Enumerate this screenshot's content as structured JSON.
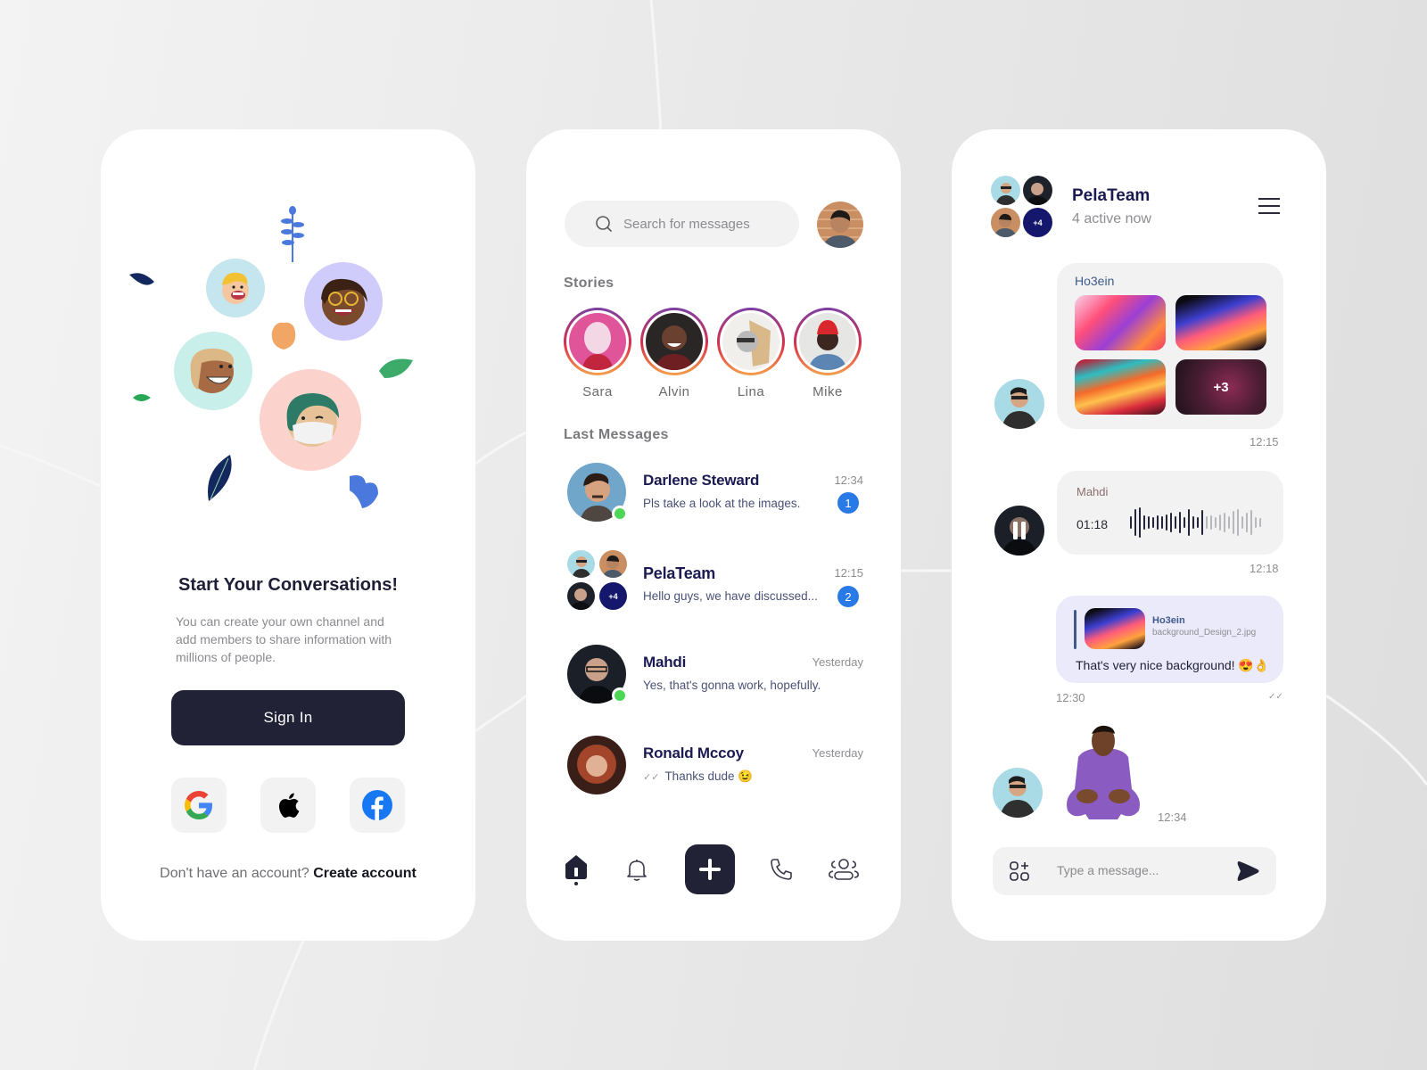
{
  "colors": {
    "primary_dark": "#212236",
    "name_navy": "#1b1b52",
    "badge_blue": "#2979e6",
    "online_green": "#4cd855",
    "group_plus_bg": "#14176b",
    "reply_bubble": "#ebeafa"
  },
  "onboarding": {
    "illustration_icons": [
      "boy-blonde-avatar",
      "girl-glasses-avatar",
      "girl-smiling-avatar",
      "girl-masked-avatar",
      "leaf-decor"
    ],
    "title": "Start Your Conversations!",
    "description": "You can create your own channel and add members to share information with millions of people.",
    "sign_in_label": "Sign In",
    "social_logins": [
      {
        "name": "Google",
        "icon": "google-icon"
      },
      {
        "name": "Apple",
        "icon": "apple-icon"
      },
      {
        "name": "Facebook",
        "icon": "facebook-icon"
      }
    ],
    "footer_prompt": "Don't have an account?",
    "footer_link": "Create account"
  },
  "inbox": {
    "search_placeholder": "Search for messages",
    "stories_label": "Stories",
    "stories": [
      {
        "name": "Sara"
      },
      {
        "name": "Alvin"
      },
      {
        "name": "Lina"
      },
      {
        "name": "Mike"
      }
    ],
    "last_messages_label": "Last Messages",
    "messages": [
      {
        "name": "Darlene Steward",
        "preview": "Pls take a look at the images.",
        "time": "12:34",
        "unread": "1",
        "online": true
      },
      {
        "name": "PelaTeam",
        "preview": "Hello guys, we have discussed...",
        "time": "12:15",
        "unread": "2",
        "group_extra": "+4"
      },
      {
        "name": "Mahdi",
        "preview": "Yes, that's gonna work, hopefully.",
        "time": "Yesterday",
        "online": true
      },
      {
        "name": "Ronald Mccoy",
        "preview": "Thanks dude 😉",
        "time": "Yesterday",
        "read_receipt": "✓✓"
      }
    ],
    "nav": [
      {
        "name": "home",
        "icon": "home-icon",
        "active": true
      },
      {
        "name": "notifications",
        "icon": "bell-icon"
      },
      {
        "name": "new",
        "icon": "plus-icon"
      },
      {
        "name": "calls",
        "icon": "phone-icon"
      },
      {
        "name": "contacts",
        "icon": "users-icon"
      }
    ]
  },
  "chat": {
    "title": "PelaTeam",
    "subtitle": "4 active now",
    "group_extra": "+4",
    "messages": [
      {
        "sender": "Ho3ein",
        "type": "images",
        "more_count": "+3",
        "time": "12:15"
      },
      {
        "sender": "Mahdi",
        "type": "voice",
        "duration": "01:18",
        "playback_progress": 0.55,
        "time": "12:18"
      },
      {
        "type": "reply",
        "quoted_sender": "Ho3ein",
        "quoted_file": "background_Design_2.jpg",
        "text": "That's very nice background! 😍👌",
        "time": "12:30",
        "read_receipt": "✓✓"
      },
      {
        "type": "sticker",
        "sticker": "pleading-3d-memoji",
        "time": "12:34"
      }
    ],
    "composer_placeholder": "Type a message..."
  }
}
